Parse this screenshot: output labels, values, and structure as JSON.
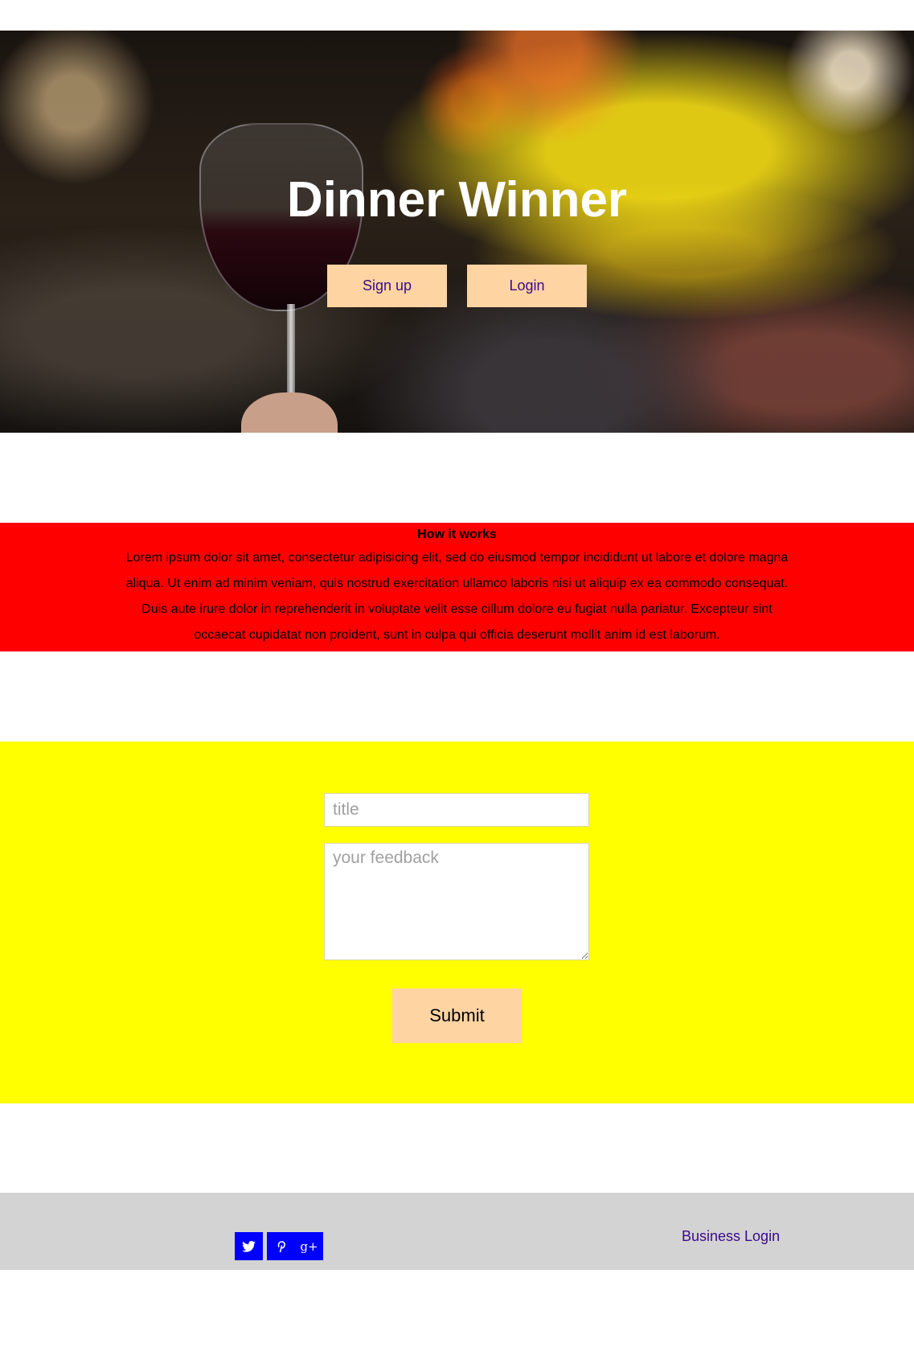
{
  "hero": {
    "title": "Dinner Winner",
    "signup_label": "Sign up",
    "login_label": "Login"
  },
  "how_it_works": {
    "heading": "How it works",
    "body": "Lorem ipsum dolor sit amet, consectetur adipisicing elit, sed do eiusmod tempor incididunt ut labore et dolore magna aliqua. Ut enim ad minim veniam, quis nostrud exercitation ullamco laboris nisi ut aliquip ex ea commodo consequat. Duis aute irure dolor in reprehenderit in voluptate velit esse cillum dolore eu fugiat nulla pariatur. Excepteur sint occaecat cupidatat non proident, sunt in culpa qui officia deserunt mollit anim id est laborum."
  },
  "feedback_form": {
    "title_placeholder": "title",
    "feedback_placeholder": "your feedback",
    "submit_label": "Submit"
  },
  "footer": {
    "social_icons": [
      "twitter-icon",
      "pinterest-icon",
      "google-plus-icon"
    ],
    "google_plus_glyph": "g+",
    "business_login_label": "Business Login"
  },
  "colors": {
    "button_bg": "#ffd4a3",
    "link_text": "#3b0a8a",
    "how_bg": "#ff0000",
    "feedback_bg": "#ffff00",
    "footer_bg": "#d3d3d3",
    "social_bg": "#0000ff"
  }
}
